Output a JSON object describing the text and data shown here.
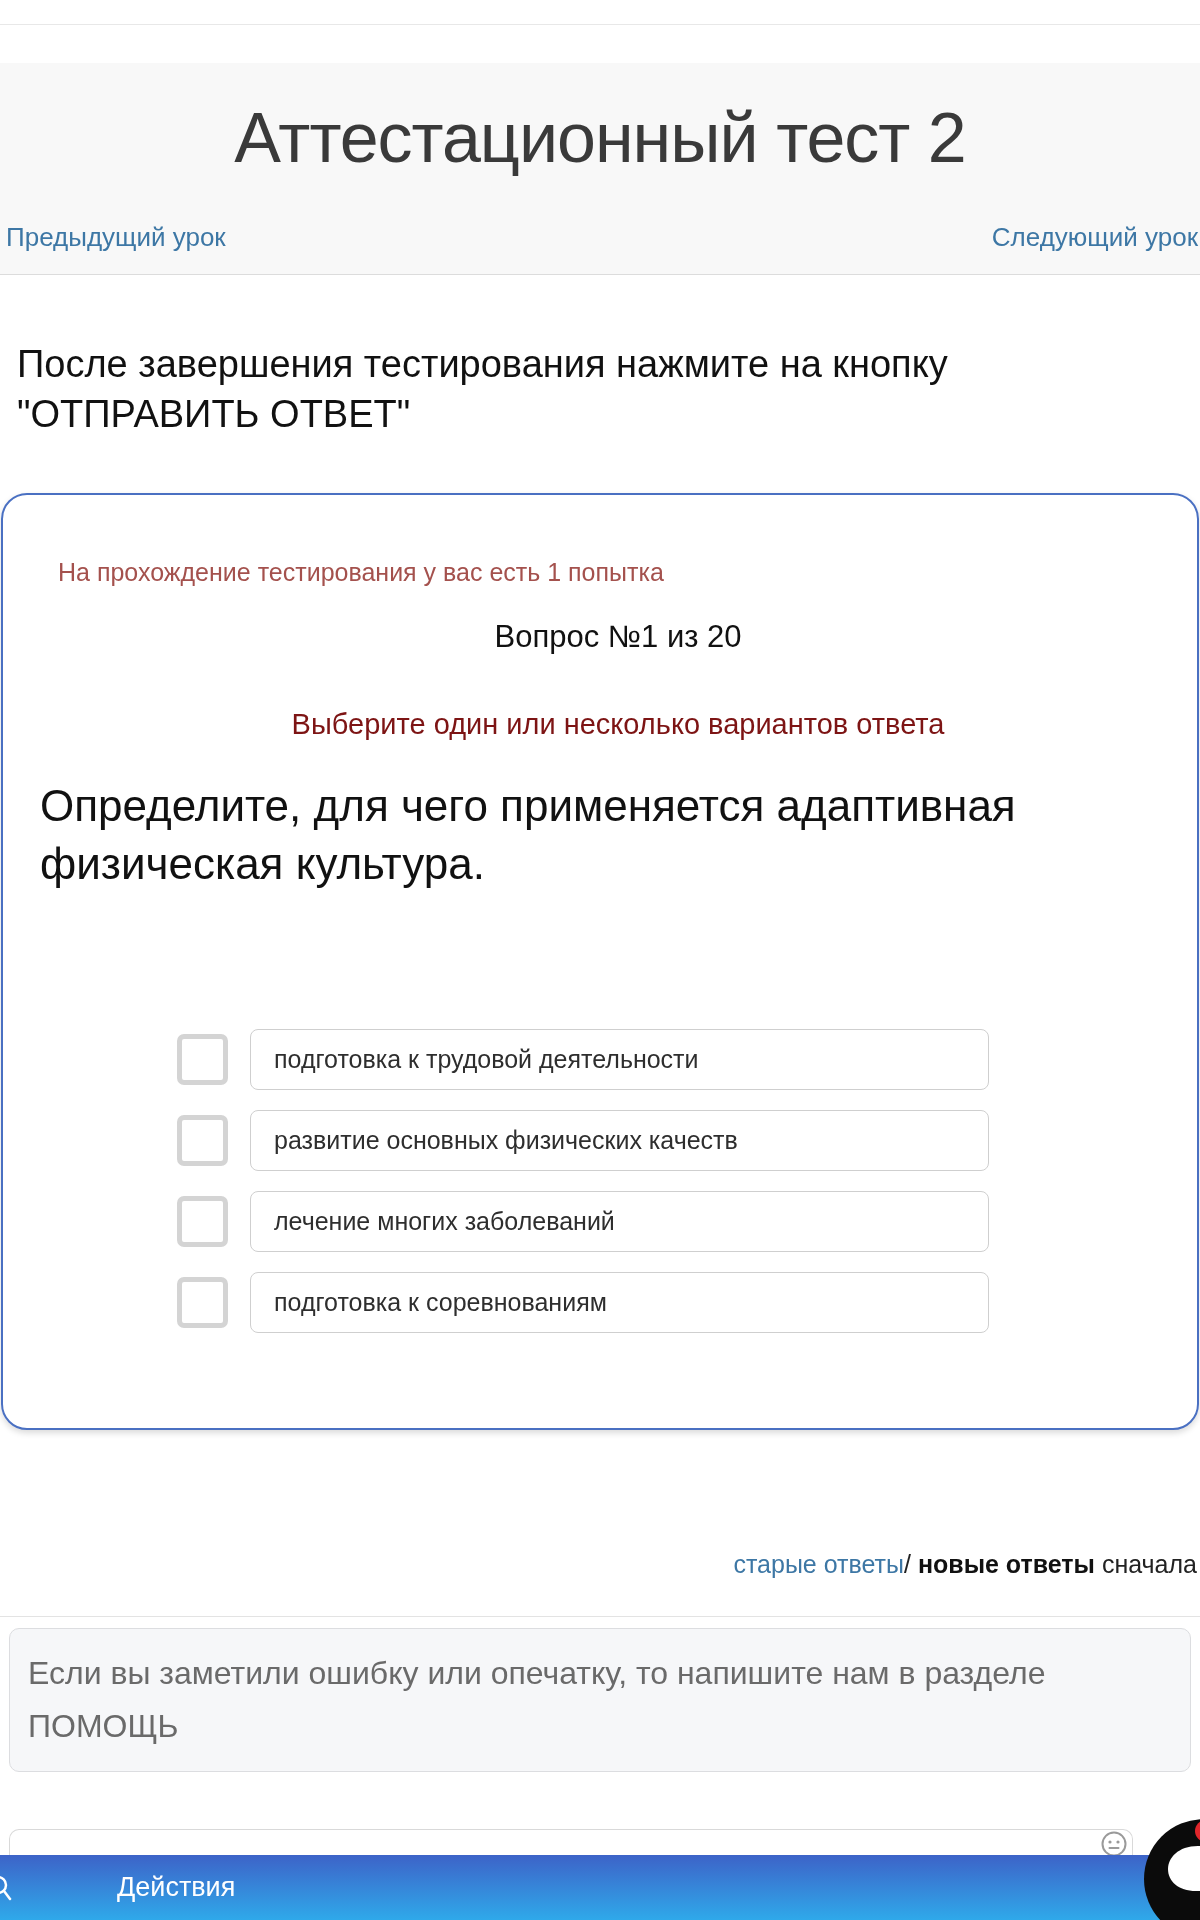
{
  "header": {
    "title": "Аттестационный тест 2",
    "prev_link": "Предыдущий урок",
    "next_link": "Следующий урок"
  },
  "instruction": "После завершения тестирования нажмите на кнопку \"ОТПРАВИТЬ ОТВЕТ\"",
  "test_card": {
    "attempts_note": "На прохождение тестирования у вас есть 1 попытка",
    "question_counter": "Вопрос №1 из 20",
    "hint": "Выберите один или несколько вариантов ответа",
    "question": "Определите, для чего применяется адаптивная физическая культура.",
    "options": [
      {
        "text": "подготовка к трудовой деятельности",
        "checked": false
      },
      {
        "text": "развитие основных физических качеств",
        "checked": false
      },
      {
        "text": "лечение многих заболеваний",
        "checked": false
      },
      {
        "text": "подготовка к соревнованиям",
        "checked": false
      }
    ]
  },
  "comments": {
    "sort_options": [
      {
        "label": "старые ответы",
        "selected": false
      },
      {
        "label": "новые ответы",
        "selected": true
      }
    ],
    "sort_separator": "/",
    "sort_suffix": "сначала",
    "notice": "Если вы заметили ошибку или опечатку, то напишите нам в разделе ПОМОЩЬ"
  },
  "bottom_bar": {
    "label": "Действия"
  }
}
